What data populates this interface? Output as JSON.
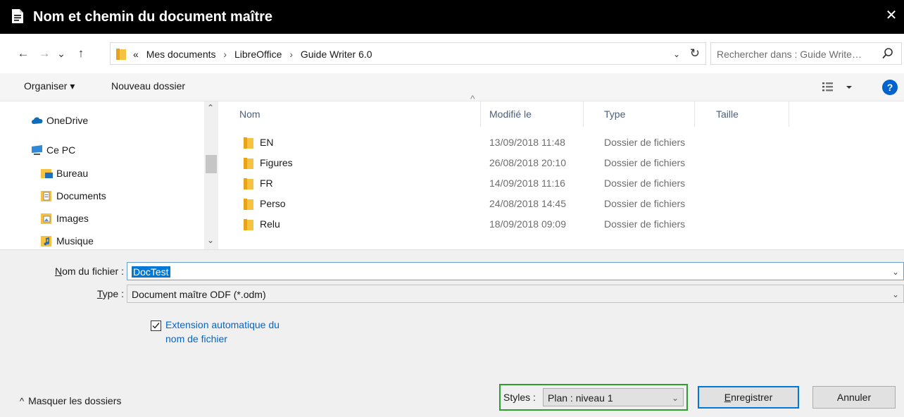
{
  "window": {
    "title": "Nom et chemin du document maître",
    "close_glyph": "✕"
  },
  "address_bar": {
    "back": "←",
    "forward": "→",
    "recent": "⌄",
    "up": "↑",
    "overflow": "«",
    "breadcrumbs": [
      "Mes documents",
      "LibreOffice",
      "Guide Writer 6.0"
    ],
    "separator": "›",
    "dropdown": "⌄",
    "refresh": "↻"
  },
  "search": {
    "placeholder": "Rechercher dans : Guide Write…"
  },
  "toolbar": {
    "organize_label": "Organiser ▾",
    "new_folder_label": "Nouveau dossier",
    "help_label": "?"
  },
  "sidebar": {
    "items": [
      {
        "label": "OneDrive",
        "icon": "cloud-icon"
      },
      {
        "label": "Ce PC",
        "icon": "pc-icon"
      },
      {
        "label": "Bureau",
        "icon": "desktop-folder-icon"
      },
      {
        "label": "Documents",
        "icon": "documents-folder-icon"
      },
      {
        "label": "Images",
        "icon": "images-folder-icon"
      },
      {
        "label": "Musique",
        "icon": "music-folder-icon"
      }
    ],
    "scroll_up": "⌃",
    "scroll_down": "⌄"
  },
  "file_list": {
    "sort_indicator": "^",
    "columns": [
      "Nom",
      "Modifié le",
      "Type",
      "Taille"
    ],
    "rows": [
      {
        "name": "EN",
        "modified": "13/09/2018 11:48",
        "type": "Dossier de fichiers"
      },
      {
        "name": "Figures",
        "modified": "26/08/2018 20:10",
        "type": "Dossier de fichiers"
      },
      {
        "name": "FR",
        "modified": "14/09/2018 11:16",
        "type": "Dossier de fichiers"
      },
      {
        "name": "Perso",
        "modified": "24/08/2018 14:45",
        "type": "Dossier de fichiers"
      },
      {
        "name": "Relu",
        "modified": "18/09/2018 09:09",
        "type": "Dossier de fichiers"
      }
    ]
  },
  "form": {
    "filename_label_mnemonic": "N",
    "filename_label_rest": "om du fichier :",
    "filename_value": "DocTest",
    "type_label_mnemonic": "T",
    "type_label_rest": "ype :",
    "type_value": "Document maître ODF (*.odm)",
    "auto_extension_checked": true,
    "auto_extension_label": "Extension automatique du nom de fichier",
    "styles_label": "Styles :",
    "styles_value": "Plan : niveau 1",
    "chevron": "⌄"
  },
  "footer": {
    "hide_folders_label": "Masquer les dossiers",
    "hide_folders_glyph": "^",
    "save_mnemonic": "E",
    "save_rest": "nregistrer",
    "cancel_label": "Annuler"
  },
  "colors": {
    "titlebar": "#000000",
    "accent": "#0078d7",
    "folder": "#f5c242",
    "styles_highlight": "#2e9e2e",
    "link": "#0066cc"
  }
}
